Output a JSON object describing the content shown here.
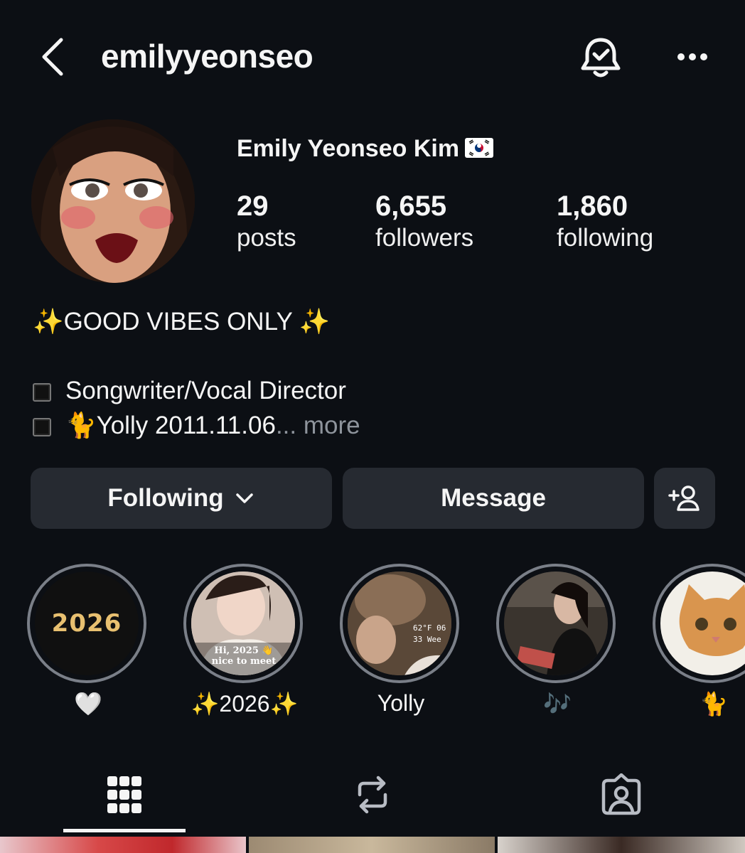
{
  "header": {
    "username": "emilyyeonseo",
    "icons": [
      "chevron-left-icon",
      "bell-check-icon",
      "more-horizontal-icon"
    ]
  },
  "profile": {
    "full_name": "Emily Yeonseo Kim",
    "flag_icon": "south-korea-flag-icon",
    "stats": {
      "posts": {
        "value": "29",
        "label": "posts"
      },
      "followers": {
        "value": "6,655",
        "label": "followers"
      },
      "following": {
        "value": "1,860",
        "label": "following"
      }
    }
  },
  "bio": {
    "line1": "✨GOOD VIBES ONLY ✨",
    "line3": "Songwriter/Vocal Director",
    "line4": "🐈Yolly 2011.11.06",
    "ellipsis": "...",
    "more_label": "more"
  },
  "actions": {
    "following_label": "Following",
    "message_label": "Message",
    "add_icon": "add-person-icon"
  },
  "highlights": [
    {
      "label": "🤍",
      "cover_text": "2026"
    },
    {
      "label": "✨2026✨",
      "cover_text": "Hi, 2025 👋 nice to meet"
    },
    {
      "label": "Yolly",
      "cover_text": "62°F 06 33 Wee"
    },
    {
      "label": "🎶"
    },
    {
      "label": "🐈"
    }
  ],
  "tabs": [
    "grid-icon",
    "reposts-icon",
    "tagged-icon"
  ],
  "colors": {
    "background": "#0c0f14",
    "button": "#262a31",
    "muted": "#8e949c"
  }
}
